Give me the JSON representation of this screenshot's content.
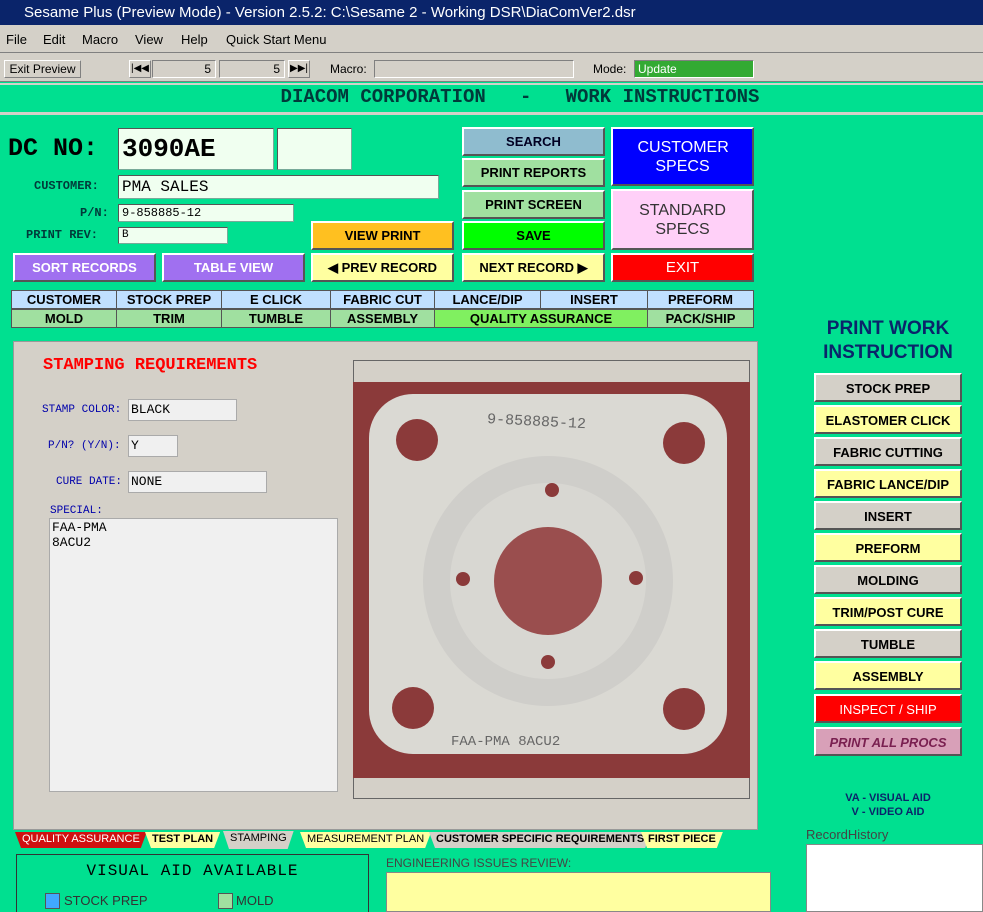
{
  "window": {
    "title": "Sesame Plus (Preview Mode) - Version 2.5.2: C:\\Sesame 2 - Working DSR\\DiaComVer2.dsr",
    "icon_letter": "S"
  },
  "menu": [
    "File",
    "Edit",
    "Macro",
    "View",
    "Help",
    "Quick Start Menu"
  ],
  "toolbar": {
    "exit_preview": "Exit Preview",
    "record_current": "5",
    "record_total": "5",
    "macro_label": "Macro:",
    "mode_label": "Mode:",
    "mode_value": "Update"
  },
  "header": {
    "title": "DIACOM CORPORATION   -   WORK INSTRUCTIONS"
  },
  "record": {
    "dc_label": "DC NO:",
    "dc_value": "3090AE",
    "dc_extra": "",
    "customer_label": "CUSTOMER:",
    "customer_value": "PMA SALES",
    "pn_label": "P/N:",
    "pn_value": "9-858885-12",
    "rev_label": "PRINT REV:",
    "rev_value": "B"
  },
  "buttons": {
    "search": "SEARCH",
    "print_reports": "PRINT REPORTS",
    "print_screen": "PRINT SCREEN",
    "save": "SAVE",
    "view_print": "VIEW PRINT",
    "prev_record": "PREV RECORD",
    "next_record": "NEXT RECORD",
    "sort_records": "SORT RECORDS",
    "table_view": "TABLE VIEW",
    "customer_specs": "CUSTOMER SPECS",
    "standard_specs": "STANDARD SPECS",
    "exit": "EXIT"
  },
  "nav_row1": [
    "CUSTOMER",
    "STOCK PREP",
    "E CLICK",
    "FABRIC CUT",
    "LANCE/DIP",
    "INSERT",
    "PREFORM"
  ],
  "nav_row2": [
    "MOLD",
    "TRIM",
    "TUMBLE",
    "ASSEMBLY",
    "QUALITY ASSURANCE",
    "PACK/SHIP"
  ],
  "stamping": {
    "title": "STAMPING REQUIREMENTS",
    "stamp_color_label": "STAMP COLOR:",
    "stamp_color_value": "BLACK",
    "pn_yn_label": "P/N? (Y/N):",
    "pn_yn_value": "Y",
    "cure_date_label": "CURE DATE:",
    "cure_date_value": "NONE",
    "special_label": "SPECIAL:",
    "special_line1": "FAA-PMA",
    "special_line2": "8ACU2"
  },
  "photo": {
    "top_text": "9-858885-12",
    "bottom_text": "FAA-PMA  8ACU2"
  },
  "print_work": {
    "title_line1": "PRINT WORK",
    "title_line2": "INSTRUCTION",
    "items": [
      "STOCK PREP",
      "ELASTOMER  CLICK",
      "FABRIC CUTTING",
      "FABRIC LANCE/DIP",
      "INSERT",
      "PREFORM",
      "MOLDING",
      "TRIM/POST CURE",
      "TUMBLE",
      "ASSEMBLY",
      "INSPECT / SHIP",
      "PRINT ALL PROCS"
    ]
  },
  "legend": {
    "va": "VA - VISUAL AID",
    "v": "V - VIDEO AID"
  },
  "tabs": [
    "QUALITY ASSURANCE",
    "TEST PLAN",
    "STAMPING",
    "MEASUREMENT PLAN",
    "CUSTOMER SPECIFIC REQUIREMENTS",
    "FIRST PIECE"
  ],
  "visual_aid": {
    "title": "VISUAL AID AVAILABLE",
    "stock_prep": "STOCK PREP",
    "mold": "MOLD"
  },
  "engineering": {
    "label": "ENGINEERING ISSUES REVIEW:"
  },
  "record_history": {
    "label": "RecordHistory"
  },
  "colors": {
    "background": "#00e090",
    "blue": "#0000ff",
    "red": "#ff0000",
    "purple": "#a070f0",
    "yellow": "#ffffa0",
    "grey": "#d4d0c8",
    "green": "#00ff00"
  }
}
